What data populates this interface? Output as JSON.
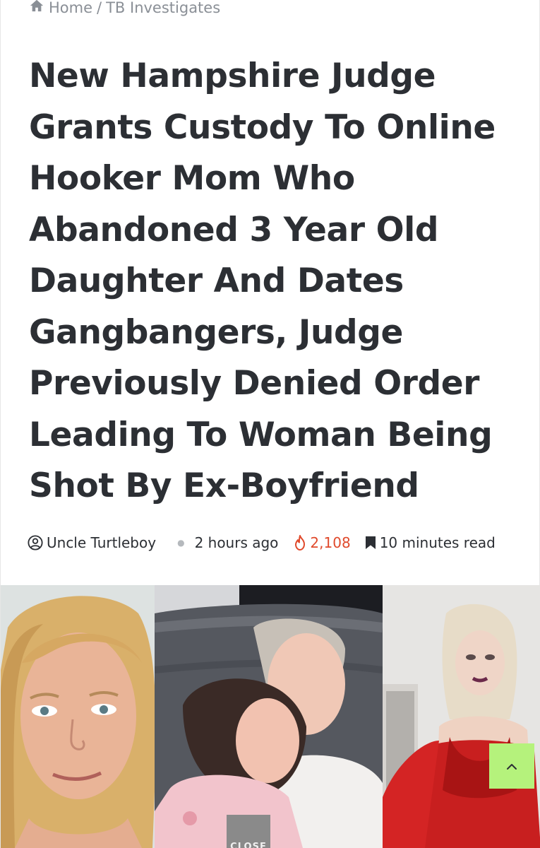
{
  "breadcrumb": {
    "home": "Home",
    "separator": "/",
    "section": "TB Investigates"
  },
  "article": {
    "title": "New Hampshire Judge Grants Custody To Online Hooker Mom Who Abandoned 3 Year Old Daughter And Dates Gangbangers, Judge Previously Denied Order Leading To Woman Being Shot By Ex-Boyfriend",
    "author": "Uncle Turtleboy",
    "time": "2 hours ago",
    "views": "2,108",
    "read_time": "10 minutes read"
  },
  "overlay": {
    "close_label": "CLOSE"
  },
  "icons": {
    "home": "home-icon",
    "author": "user-circle-icon",
    "views": "fire-icon",
    "read": "bookmark-icon",
    "scroll_top": "chevron-up-icon"
  },
  "colors": {
    "text": "#2c2f34",
    "muted": "#8a8f96",
    "views": "#e04a2c",
    "scroll_button": "#b5f27c"
  }
}
